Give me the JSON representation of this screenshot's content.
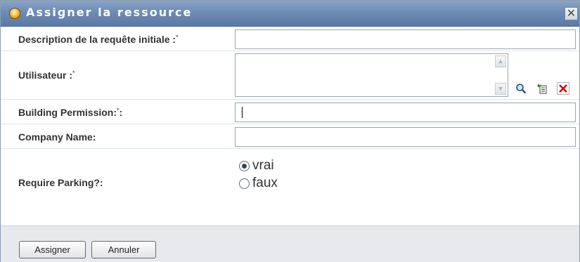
{
  "dialog": {
    "title": "Assigner la ressource",
    "close_glyph": "✕"
  },
  "form": {
    "description_label": "Description de la requête initiale :",
    "description_value": "",
    "user_label": "Utilisateur :",
    "user_value": "",
    "building_label": "Building Permission:",
    "building_label_suffix": ":",
    "building_value": "",
    "company_label": "Company Name:",
    "company_value": "",
    "parking_label": "Require Parking?:",
    "parking_options": [
      {
        "label": "vrai",
        "selected": true
      },
      {
        "label": "faux",
        "selected": false
      }
    ],
    "required_marker": "*"
  },
  "icons": {
    "search": "search-icon",
    "history": "history-icon",
    "clear": "clear-icon",
    "clear_color": "#d40000"
  },
  "footer": {
    "assign_label": "Assigner",
    "cancel_label": "Annuler"
  }
}
